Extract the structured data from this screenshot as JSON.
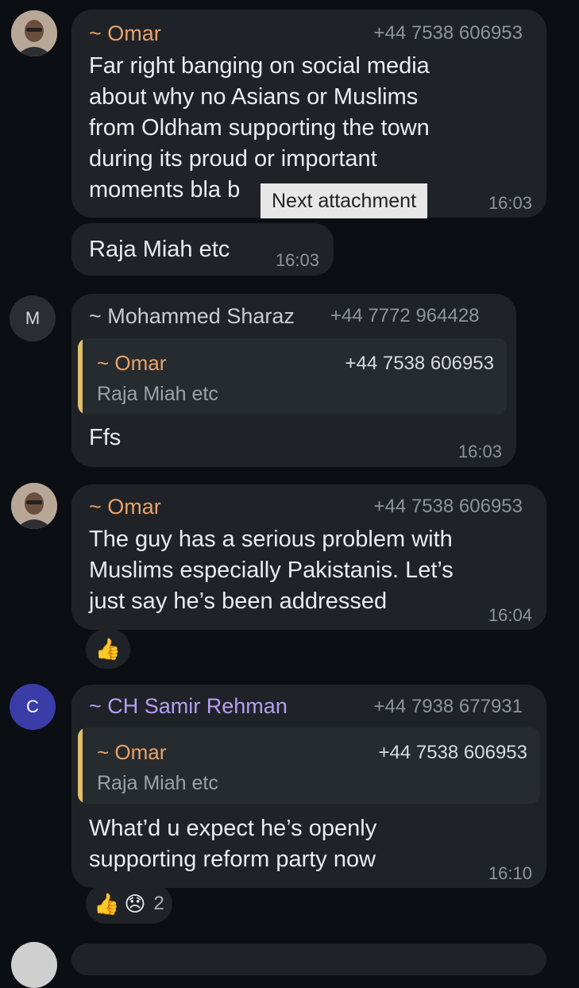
{
  "messages": [
    {
      "sender": "~ Omar",
      "phone": "+44 7538 606953",
      "lines": [
        "Far right banging on social media",
        "about why no Asians or Muslims",
        "from Oldham supporting the town",
        "during its proud or important",
        "moments bla b"
      ],
      "time": "16:03"
    },
    {
      "text": "Raja Miah etc",
      "time": "16:03"
    },
    {
      "avatar_letter": "M",
      "sender": "~ Mohammed Sharaz",
      "phone": "+44 7772 964428",
      "quote": {
        "sender": "~ Omar",
        "phone": "+44 7538 606953",
        "text": "Raja Miah etc"
      },
      "text": "Ffs",
      "time": "16:03"
    },
    {
      "sender": "~ Omar",
      "phone": "+44 7538 606953",
      "lines": [
        "The guy has a serious problem with",
        "Muslims especially Pakistanis. Let’s",
        "just say he’s been addressed"
      ],
      "time": "16:04",
      "reaction": {
        "emoji": "👍"
      }
    },
    {
      "avatar_letter": "C",
      "sender": "~ CH Samir Rehman",
      "phone": "+44 7938 677931",
      "quote": {
        "sender": "~ Omar",
        "phone": "+44 7538 606953",
        "text": "Raja Miah etc"
      },
      "lines": [
        "What’d u expect he’s openly",
        "supporting reform party now"
      ],
      "time": "16:10",
      "reactions": {
        "emojis": [
          "👍",
          "😞"
        ],
        "count": "2"
      }
    }
  ],
  "tooltip": "Next attachment",
  "colors": {
    "background": "#0b0e13",
    "bubble": "#1f2327",
    "omar_name": "#e8a26a",
    "sharaz_name": "#c8cdd0",
    "samir_name": "#b69cf5",
    "quote_bar": "#e0c06a",
    "avatar_c": "#3a3ca8"
  }
}
